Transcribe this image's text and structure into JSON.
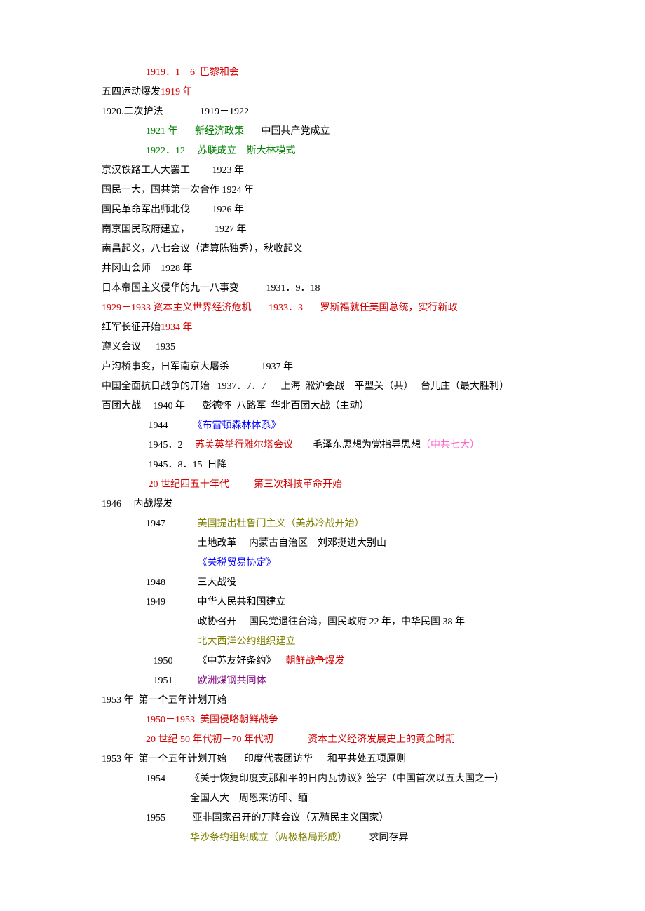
{
  "lines": [
    {
      "indent": "                  ",
      "segments": [
        {
          "t": "1919．1－6  巴黎和会",
          "c": "red"
        }
      ]
    },
    {
      "indent": "",
      "segments": [
        {
          "t": "五四运动爆发"
        },
        {
          "t": "1919 年",
          "c": "red"
        }
      ]
    },
    {
      "indent": "",
      "segments": [
        {
          "t": "1920.二次护法               1919－1922"
        }
      ]
    },
    {
      "indent": "                  ",
      "segments": [
        {
          "t": "1921 年       新经济政策",
          "c": "green"
        },
        {
          "t": "       中国共产党成立"
        }
      ]
    },
    {
      "indent": "                  ",
      "segments": [
        {
          "t": "1922．12     苏联成立    斯大林模式",
          "c": "green"
        }
      ]
    },
    {
      "indent": "",
      "segments": [
        {
          "t": "京汉铁路工人大罢工         1923 年"
        }
      ]
    },
    {
      "indent": "",
      "segments": [
        {
          "t": "国民一大，国共第一次合作 1924 年"
        }
      ]
    },
    {
      "indent": "",
      "segments": [
        {
          "t": "国民革命军出师北伐         1926 年"
        }
      ]
    },
    {
      "indent": "",
      "segments": [
        {
          "t": "南京国民政府建立，          1927 年"
        }
      ]
    },
    {
      "indent": "",
      "segments": [
        {
          "t": "南昌起义，八七会议（清算陈独秀），秋收起义"
        }
      ]
    },
    {
      "indent": "",
      "segments": [
        {
          "t": "井冈山会师    1928 年"
        }
      ]
    },
    {
      "indent": "",
      "segments": [
        {
          "t": "日本帝国主义侵华的九一八事变           1931．9．18"
        }
      ]
    },
    {
      "indent": "",
      "segments": [
        {
          "t": "1929－1933 资本主义世界经济危机       1933．3       罗斯福就任美国总统，实行新政",
          "c": "red"
        }
      ]
    },
    {
      "indent": "",
      "segments": [
        {
          "t": "红军长征开始"
        },
        {
          "t": "1934 年",
          "c": "red"
        }
      ]
    },
    {
      "indent": "",
      "segments": [
        {
          "t": "遵义会议      1935"
        }
      ]
    },
    {
      "indent": "",
      "segments": [
        {
          "t": "卢沟桥事变，日军南京大屠杀             1937 年"
        }
      ]
    },
    {
      "indent": "",
      "segments": [
        {
          "t": "中国全面抗日战争的开始   1937．7．7      上海  淞沪会战    平型关（共）   台儿庄（最大胜利）"
        }
      ]
    },
    {
      "indent": "",
      "segments": [
        {
          "t": "百团大战     1940 年       彭德怀  八路军  华北百团大战（主动）"
        }
      ]
    },
    {
      "indent": "                  ",
      "segments": [
        {
          "t": " 1944          "
        },
        {
          "t": "《布雷顿森林体系》",
          "c": "blue"
        }
      ]
    },
    {
      "indent": "                  ",
      "segments": [
        {
          "t": " 1945．2     "
        },
        {
          "t": "苏美英举行雅尔塔会议",
          "c": "red"
        },
        {
          "t": "        毛泽东思想为党指导思想"
        },
        {
          "t": "（中共七大）",
          "c": "pink"
        }
      ]
    },
    {
      "indent": "                  ",
      "segments": [
        {
          "t": " 1945．8．15  日降"
        }
      ]
    },
    {
      "indent": "                  ",
      "segments": [
        {
          "t": " 20 世纪四五十年代          第三次科技革命开始",
          "c": "red"
        }
      ]
    },
    {
      "indent": "",
      "segments": [
        {
          "t": "1946     内战爆发"
        }
      ]
    },
    {
      "indent": "                  ",
      "segments": [
        {
          "t": "1947             "
        },
        {
          "t": "美国提出杜鲁门主义（美苏冷战开始）",
          "c": "olive"
        }
      ]
    },
    {
      "indent": "                  ",
      "segments": [
        {
          "t": "                     土地改革     内蒙古自治区    刘邓挺进大别山"
        }
      ]
    },
    {
      "indent": "                  ",
      "segments": [
        {
          "t": "                     "
        },
        {
          "t": "《关税贸易协定》",
          "c": "blue"
        }
      ]
    },
    {
      "indent": "                  ",
      "segments": [
        {
          "t": "1948             三大战役"
        }
      ]
    },
    {
      "indent": "                  ",
      "segments": [
        {
          "t": "1949             中华人民共和国建立"
        }
      ]
    },
    {
      "indent": "                  ",
      "segments": [
        {
          "t": "                     政协召开     国民党退往台湾，国民政府 22 年，中华民国 38 年"
        }
      ]
    },
    {
      "indent": "                  ",
      "segments": [
        {
          "t": "                     "
        },
        {
          "t": "北大西洋公约组织建立",
          "c": "olive"
        }
      ]
    },
    {
      "indent": "                  ",
      "segments": [
        {
          "t": "   1950          《中苏友好条约》    "
        },
        {
          "t": "朝鲜战争爆发",
          "c": "red"
        }
      ]
    },
    {
      "indent": "                  ",
      "segments": [
        {
          "t": "   1951          "
        },
        {
          "t": "欧洲煤钢共同体",
          "c": "purple"
        }
      ]
    },
    {
      "indent": "",
      "segments": [
        {
          "t": "1953 年  第一个五年计划开始"
        }
      ]
    },
    {
      "indent": "                  ",
      "segments": [
        {
          "t": "1950－1953  美国侵略朝鲜战争",
          "c": "red"
        }
      ]
    },
    {
      "indent": "                  ",
      "segments": [
        {
          "t": "20 世纪 50 年代初－70 年代初              资本主义经济发展史上的黄金时期",
          "c": "red"
        }
      ]
    },
    {
      "indent": "",
      "segments": [
        {
          "t": "1953 年  第一个五年计划开始       印度代表团访华      和平共处五项原则"
        }
      ]
    },
    {
      "indent": "                  ",
      "segments": [
        {
          "t": "1954          《关于恢复印度支那和平的日内瓦协议》签字（中国首次以五大国之一）"
        }
      ]
    },
    {
      "indent": "                  ",
      "segments": [
        {
          "t": "                  全国人大    周恩来访印、缅"
        }
      ]
    },
    {
      "indent": "                  ",
      "segments": [
        {
          "t": "1955           亚非国家召开的万隆会议（无殖民主义国家）"
        }
      ]
    },
    {
      "indent": "                  ",
      "segments": [
        {
          "t": "                  "
        },
        {
          "t": "华沙条约组织成立（两极格局形成）",
          "c": "olive"
        },
        {
          "t": "         求同存异"
        }
      ]
    }
  ]
}
